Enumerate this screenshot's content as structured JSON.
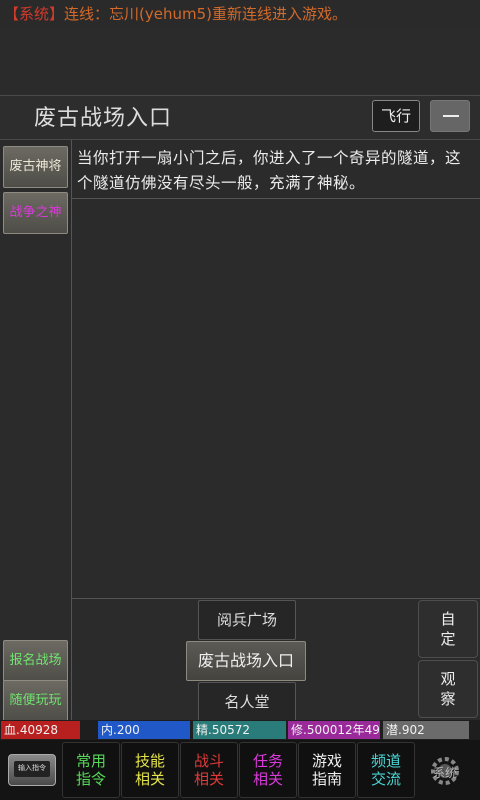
{
  "system_message": {
    "tag": "【系统】",
    "text": "连线：忘川(yehum5)重新连线进入游戏。"
  },
  "header": {
    "title": "废古战场入口",
    "fly_label": "飞行"
  },
  "left_buttons": {
    "top": [
      "废古神将",
      "战争之神"
    ],
    "bottom": [
      "报名战场",
      "随便玩玩"
    ]
  },
  "room_description": "当你打开一扇小门之后，你进入了一个奇异的隧道，这个隧道仿佛没有尽头一般，充满了神秘。",
  "exits": {
    "north": "阅兵广场",
    "current": "废古战场入口",
    "south": "名人堂"
  },
  "side_actions": {
    "custom": [
      "自",
      "定"
    ],
    "observe": [
      "观",
      "察"
    ]
  },
  "stats": {
    "hp": "血.40928",
    "nei": "内.200",
    "jing": "精.50572",
    "xiu": "修.500012年49",
    "qian": "潜.902"
  },
  "bottom_bar": {
    "input_label": "输入指令",
    "tabs": [
      {
        "line1": "常用",
        "line2": "指令"
      },
      {
        "line1": "技能",
        "line2": "相关"
      },
      {
        "line1": "战斗",
        "line2": "相关"
      },
      {
        "line1": "任务",
        "line2": "相关"
      },
      {
        "line1": "游戏",
        "line2": "指南"
      },
      {
        "line1": "频道",
        "line2": "交流"
      }
    ],
    "system_label": "系统"
  },
  "colors": {
    "system_tag": "#d23a2a",
    "system_text": "#d26a2a",
    "hp": "#b81f1f",
    "nei": "#2058c7",
    "jing": "#2a7c7a",
    "xiu": "#9a2a9a",
    "qian": "#6b6b6b"
  }
}
